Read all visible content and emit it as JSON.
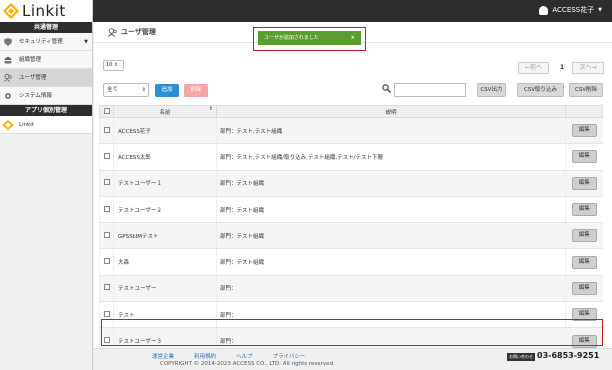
{
  "header": {
    "logo_text": "Linkit",
    "user_name": "ACCESS花子"
  },
  "sidebar": {
    "common_heading": "共通管理",
    "items": [
      {
        "label": "セキュリティ管理",
        "icon": "shield-icon"
      },
      {
        "label": "組織管理",
        "icon": "org-icon"
      },
      {
        "label": "ユーザ管理",
        "icon": "users-icon"
      },
      {
        "label": "システム情報",
        "icon": "gear-icon"
      }
    ],
    "app_heading": "アプリ個別管理",
    "app_items": [
      {
        "label": "Linkit",
        "icon": "linkit-logo-icon"
      }
    ]
  },
  "page": {
    "title": "ユーザ管理"
  },
  "toast": {
    "message": "ユーザが追加されました",
    "close": "×"
  },
  "toolbar": {
    "per_page": "10",
    "filter_value": "全て",
    "add_label": "追加",
    "delete_label": "削除",
    "csv_export": "CSV出力",
    "csv_import": "CSV取り込み",
    "csv_delete": "CSV削除"
  },
  "pager": {
    "prev": "←前へ",
    "current": "1",
    "next": "次へ→"
  },
  "table": {
    "columns": [
      "名前",
      "説明"
    ],
    "edit_label": "編集",
    "rows": [
      {
        "name": "ACCESS花子",
        "desc": "部門：テスト,テスト組織"
      },
      {
        "name": "ACCESS太郎",
        "desc": "部門：テスト,テスト組織/取り込み,テスト組織,テスト/テスト下層"
      },
      {
        "name": "テストユーザー１",
        "desc": "部門：テスト組織"
      },
      {
        "name": "テストユーザー２",
        "desc": "部門：テスト組織"
      },
      {
        "name": "GPSSLIMテスト",
        "desc": "部門：テスト組織"
      },
      {
        "name": "大森",
        "desc": "部門：テスト組織"
      },
      {
        "name": "テストユーザー",
        "desc": "部門："
      },
      {
        "name": "テスト",
        "desc": "部門："
      },
      {
        "name": "テストユーザー３",
        "desc": "部門："
      }
    ]
  },
  "footer": {
    "links": [
      "運営企業",
      "利用規約",
      "ヘルプ",
      "プライバシー"
    ],
    "copyright": "COPYRIGHT © 2014-2023 ACCESS CO., LTD. All rights reserved.",
    "contact_label": "お問い合わせ",
    "phone": "03-6853-9251"
  },
  "colors": {
    "topbar": "#2d2d2d",
    "toast": "#5a9e2f",
    "add_button": "#2a8fd4",
    "delete_button": "#f3a6a6",
    "highlight": "#c0202a"
  }
}
